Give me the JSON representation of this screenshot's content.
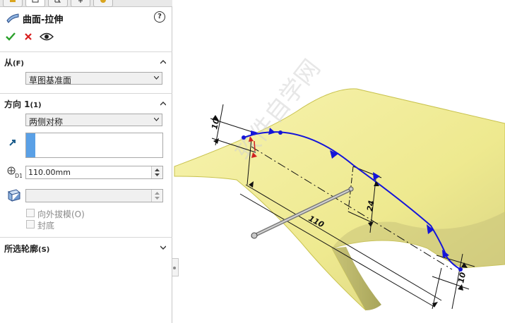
{
  "feature": {
    "title": "曲面-拉伸"
  },
  "from_section": {
    "title": "从",
    "shortcut": "(F)",
    "value": "草图基准面"
  },
  "direction_section": {
    "title": "方向 1",
    "shortcut": "(1)",
    "end_condition": "两侧对称",
    "depth": "110.00mm"
  },
  "options": {
    "draft_outward": "向外拔模(O)",
    "cap_end": "封底"
  },
  "contours_section": {
    "title": "所选轮廓",
    "shortcut": "(S)"
  },
  "viewport": {
    "dimensions": {
      "left_small": "10",
      "right_small": "10",
      "vertical": "24",
      "length": "110"
    },
    "watermark": "软件自学网",
    "colors": {
      "surface": "#f3ef9c",
      "sketch": "#1515d8",
      "dimension": "#111111"
    }
  }
}
